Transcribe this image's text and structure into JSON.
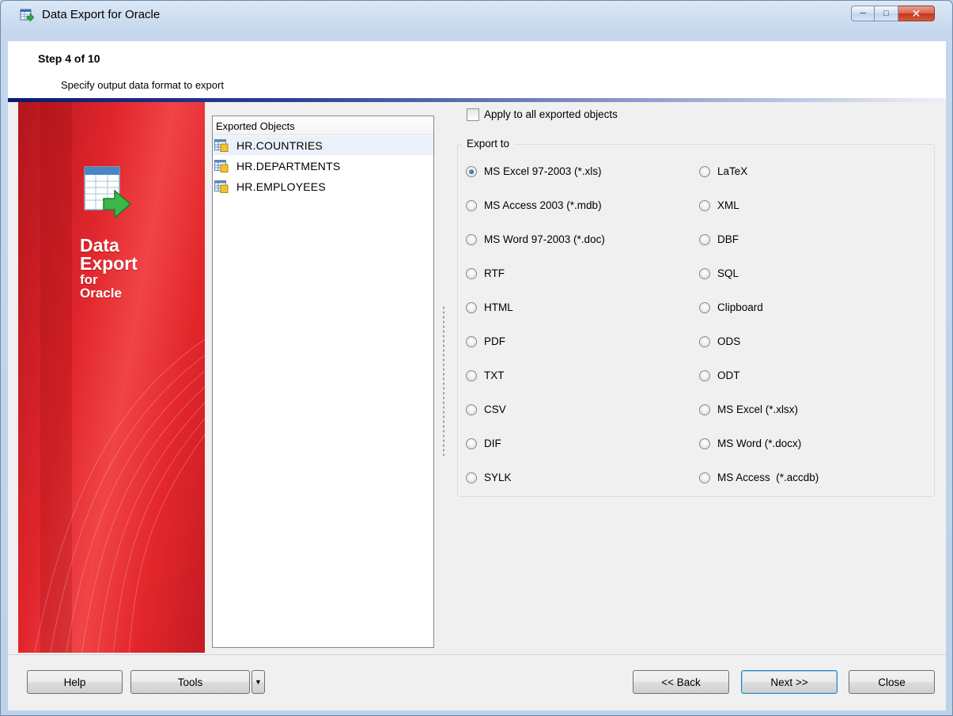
{
  "window": {
    "title": "Data Export for Oracle",
    "controls": {
      "minimize": "minimize-icon",
      "maximize": "maximize-icon",
      "close": "close-icon"
    }
  },
  "header": {
    "step": "Step 4 of 10",
    "description": "Specify output data format to export"
  },
  "banner": {
    "line1": "Data",
    "line2": "Export",
    "line3": "for",
    "line4": "Oracle"
  },
  "objects": {
    "header": "Exported Objects",
    "items": [
      {
        "label": "HR.COUNTRIES",
        "selected": true,
        "icon": "table-icon"
      },
      {
        "label": "HR.DEPARTMENTS",
        "selected": false,
        "icon": "table-icon"
      },
      {
        "label": "HR.EMPLOYEES",
        "selected": false,
        "icon": "table-icon"
      }
    ]
  },
  "apply_all": {
    "label": "Apply to all exported objects",
    "checked": false
  },
  "export_to": {
    "legend": "Export to",
    "selected": "MS Excel 97-2003 (*.xls)",
    "left": [
      "MS Excel 97-2003 (*.xls)",
      "MS Access 2003 (*.mdb)",
      "MS Word 97-2003 (*.doc)",
      "RTF",
      "HTML",
      "PDF",
      "TXT",
      "CSV",
      "DIF",
      "SYLK"
    ],
    "right": [
      "LaTeX",
      "XML",
      "DBF",
      "SQL",
      "Clipboard",
      "ODS",
      "ODT",
      "MS Excel (*.xlsx)",
      "MS Word (*.docx)",
      "MS Access  (*.accdb)"
    ]
  },
  "buttons": {
    "help": "Help",
    "tools": "Tools",
    "tools_arrow": "▼",
    "back": "<< Back",
    "next": "Next >>",
    "close": "Close"
  },
  "colors": {
    "banner_red": "#e1262d",
    "header_bar": "#0a1a6e",
    "selected_row": "#eaf1fa",
    "focus_border": "#3c7fb1"
  }
}
